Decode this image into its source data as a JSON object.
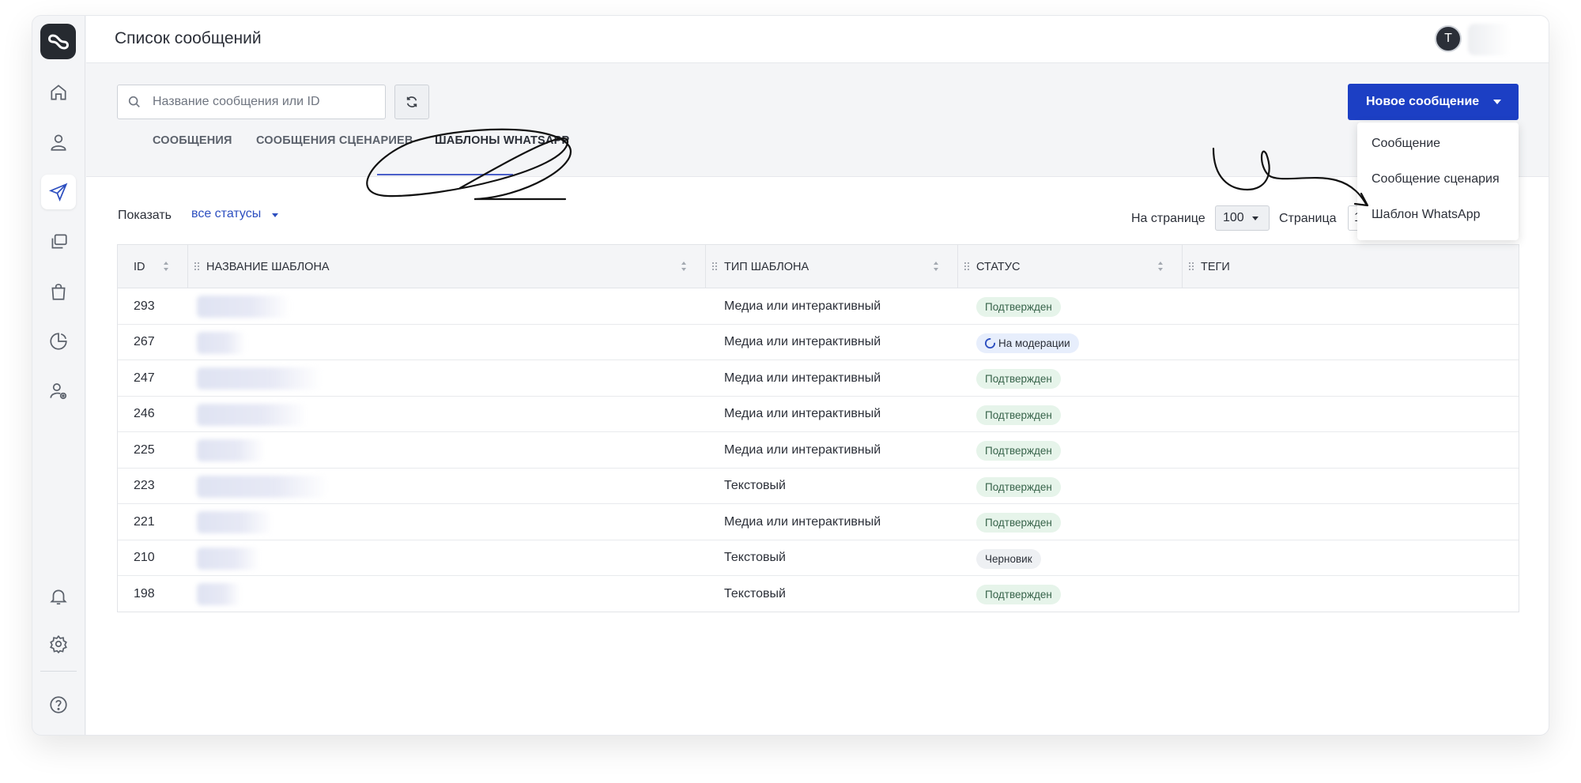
{
  "header": {
    "title": "Список сообщений",
    "avatar_initial": "T"
  },
  "sidebar": {
    "items": [
      {
        "icon": "home-icon"
      },
      {
        "icon": "user-icon"
      },
      {
        "icon": "send-icon",
        "active": true
      },
      {
        "icon": "copy-icon"
      },
      {
        "icon": "shopping-bag-icon"
      },
      {
        "icon": "pie-chart-icon"
      },
      {
        "icon": "user-settings-icon"
      }
    ],
    "bottom_items": [
      {
        "icon": "bell-icon"
      },
      {
        "icon": "gear-icon"
      },
      {
        "icon": "help-icon"
      }
    ]
  },
  "toolbar": {
    "search_placeholder": "Название сообщения или ID",
    "new_button_label": "Новое сообщение"
  },
  "new_menu": {
    "items": [
      "Сообщение",
      "Сообщение сценария",
      "Шаблон WhatsApp"
    ]
  },
  "tabs": [
    {
      "label": "СООБЩЕНИЯ",
      "active": false
    },
    {
      "label": "СООБЩЕНИЯ СЦЕНАРИЕВ",
      "active": false
    },
    {
      "label": "ШАБЛОНЫ WHATSAPP",
      "active": true
    }
  ],
  "filters": {
    "show_label": "Показать",
    "status_value": "все статусы",
    "per_page_label": "На странице",
    "per_page_value": "100",
    "page_label": "Страница",
    "page_value": "1"
  },
  "table": {
    "columns": [
      "ID",
      "НАЗВАНИЕ ШАБЛОНА",
      "ТИП ШАБЛОНА",
      "СТАТУС",
      "ТЕГИ"
    ],
    "rows": [
      {
        "id": "293",
        "type": "Медиа или интерактивный",
        "status": "Подтвержден",
        "status_kind": "approved"
      },
      {
        "id": "267",
        "type": "Медиа или интерактивный",
        "status": "На модерации",
        "status_kind": "moderation"
      },
      {
        "id": "247",
        "type": "Медиа или интерактивный",
        "status": "Подтвержден",
        "status_kind": "approved"
      },
      {
        "id": "246",
        "type": "Медиа или интерактивный",
        "status": "Подтвержден",
        "status_kind": "approved"
      },
      {
        "id": "225",
        "type": "Медиа или интерактивный",
        "status": "Подтвержден",
        "status_kind": "approved"
      },
      {
        "id": "223",
        "type": "Текстовый",
        "status": "Подтвержден",
        "status_kind": "approved"
      },
      {
        "id": "221",
        "type": "Медиа или интерактивный",
        "status": "Подтвержден",
        "status_kind": "approved"
      },
      {
        "id": "210",
        "type": "Текстовый",
        "status": "Черновик",
        "status_kind": "draft"
      },
      {
        "id": "198",
        "type": "Текстовый",
        "status": "Подтвержден",
        "status_kind": "approved"
      }
    ]
  },
  "colors": {
    "accent": "#1c3fc4",
    "link": "#2d4fc0",
    "approved_bg": "#e6f4ea",
    "moderation_bg": "#e7eefc",
    "draft_bg": "#eef0f3"
  }
}
